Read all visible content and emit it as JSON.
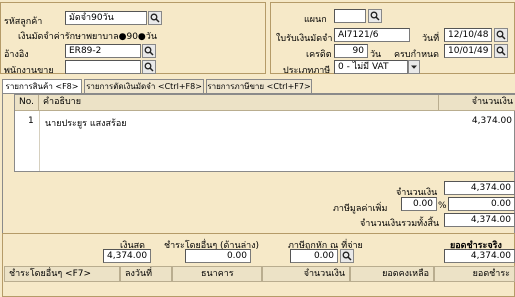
{
  "header": {
    "customer_label": "รหัสลูกค้า",
    "customer_value": "มัดจำ90วัน",
    "customer_desc": "เงินมัดจำค่ารักษาพยาบาล●90●วัน",
    "ref_label": "อ้างอิง",
    "ref_value": "ER89-2",
    "staff_label": "พนักงานขาย",
    "staff_value": "",
    "dept_label": "แผนก",
    "dept_value": "",
    "receipt_label": "ใบรับเงินมัดจำ",
    "receipt_value": "AI7121/6",
    "date_label": "วันที่",
    "date_value": "12/10/48",
    "credit_label": "เครดิต",
    "credit_value": "90",
    "credit_unit": "วัน",
    "due_label": "ครบกำหนด",
    "due_value": "10/01/49",
    "vat_label": "ประเภทภาษี",
    "vat_value": "0 - ไม่มี VAT"
  },
  "tabs": [
    {
      "label": "รายการสินค้า <F8>"
    },
    {
      "label": "รายการตัดเงินมัดจำ <Ctrl+F8>"
    },
    {
      "label": "รายการภาษีขาย <Ctrl+F7>"
    }
  ],
  "grid": {
    "columns": [
      "No.",
      "คำอธิบาย",
      "จำนวนเงิน"
    ],
    "rows": [
      {
        "no": "1",
        "desc": "นายประยูร แสงสร้อย",
        "amount": "4,374.00"
      }
    ]
  },
  "totals": {
    "amount_label": "จำนวนเงิน",
    "amount_value": "4,374.00",
    "vat_label": "ภาษีมูลค่าเพิ่ม",
    "vat_rate": "0.00",
    "vat_pct": "%",
    "vat_value": "0.00",
    "total_label": "จำนวนเงินรวมทั้งสิ้น",
    "total_value": "4,374.00"
  },
  "payment": {
    "cash_label": "เงินสด",
    "cash_value": "4,374.00",
    "other_label": "ชำระโดยอื่นๆ (ด้านล่าง)",
    "other_value": "0.00",
    "wht_label": "ภาษีถูกหัก ณ ที่จ่าย",
    "wht_value": "0.00",
    "paid_label": "ยอดชำระจริง",
    "paid_value": "4,374.00",
    "columns": [
      "ชำระโดยอื่นๆ <F7>",
      "ลงวันที่",
      "ธนาคาร",
      "จำนวนเงิน",
      "ยอดคงเหลือ",
      "ยอดชำระ"
    ]
  }
}
